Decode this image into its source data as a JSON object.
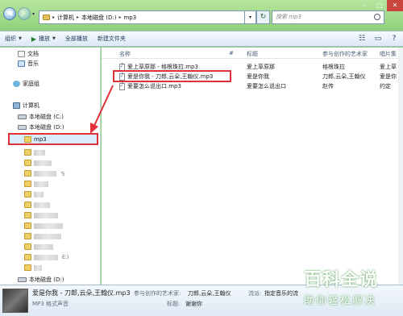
{
  "address": {
    "crumbs": [
      "计算机",
      "本地磁盘 (D:)",
      "mp3"
    ],
    "search_placeholder": "搜索 mp3"
  },
  "toolbar": {
    "organize": "组织",
    "play": "播放",
    "play_all": "全部播放",
    "new_folder": "新建文件夹"
  },
  "navpane": {
    "documents": "文档",
    "music": "音乐",
    "homegroup": "家庭组",
    "computer": "计算机",
    "drive_c": "本地磁盘 (C:)",
    "drive_d": "本地磁盘 (D:)",
    "selected_folder": "mp3",
    "partial_label_1": "ㄎ",
    "partial_label_2": "E:)",
    "drive_d_bottom": "本地磁盘 (D:)"
  },
  "columns": {
    "name": "名称",
    "number": "#",
    "title": "标题",
    "artist": "参与创作的艺术家",
    "album": "唱片集"
  },
  "files": [
    {
      "name": "爱上草原那 - 格根珠拉.mp3",
      "title": "爱上草原那",
      "artist": "格根珠拉",
      "album": "爱上草"
    },
    {
      "name": "爱是你我 - 刀郎,云朵,王翰仪.mp3",
      "title": "爱是你我",
      "artist": "刀郎,云朵,王翰仪",
      "album": "爱是你"
    },
    {
      "name": "爱要怎么说出口.mp3",
      "title": "爱要怎么说出口",
      "artist": "赵传",
      "album": "约定"
    }
  ],
  "details": {
    "filename": "爱是你我 - 刀郎,云朵,王翰仪.mp3",
    "filetype": "MP3 格式声音",
    "artist_label": "参与创作的艺术家:",
    "artist_value": "刀郎,云朵,王翰仪",
    "title_label": "标题:",
    "title_value": "谢谢你",
    "genre_label": "流派:",
    "genre_value": "指定音乐的流"
  },
  "watermark": {
    "big": "百科全说",
    "small": "助你轻松解决"
  },
  "colors": {
    "highlight": "#e0303a",
    "window_frame": "#8fd07a"
  }
}
